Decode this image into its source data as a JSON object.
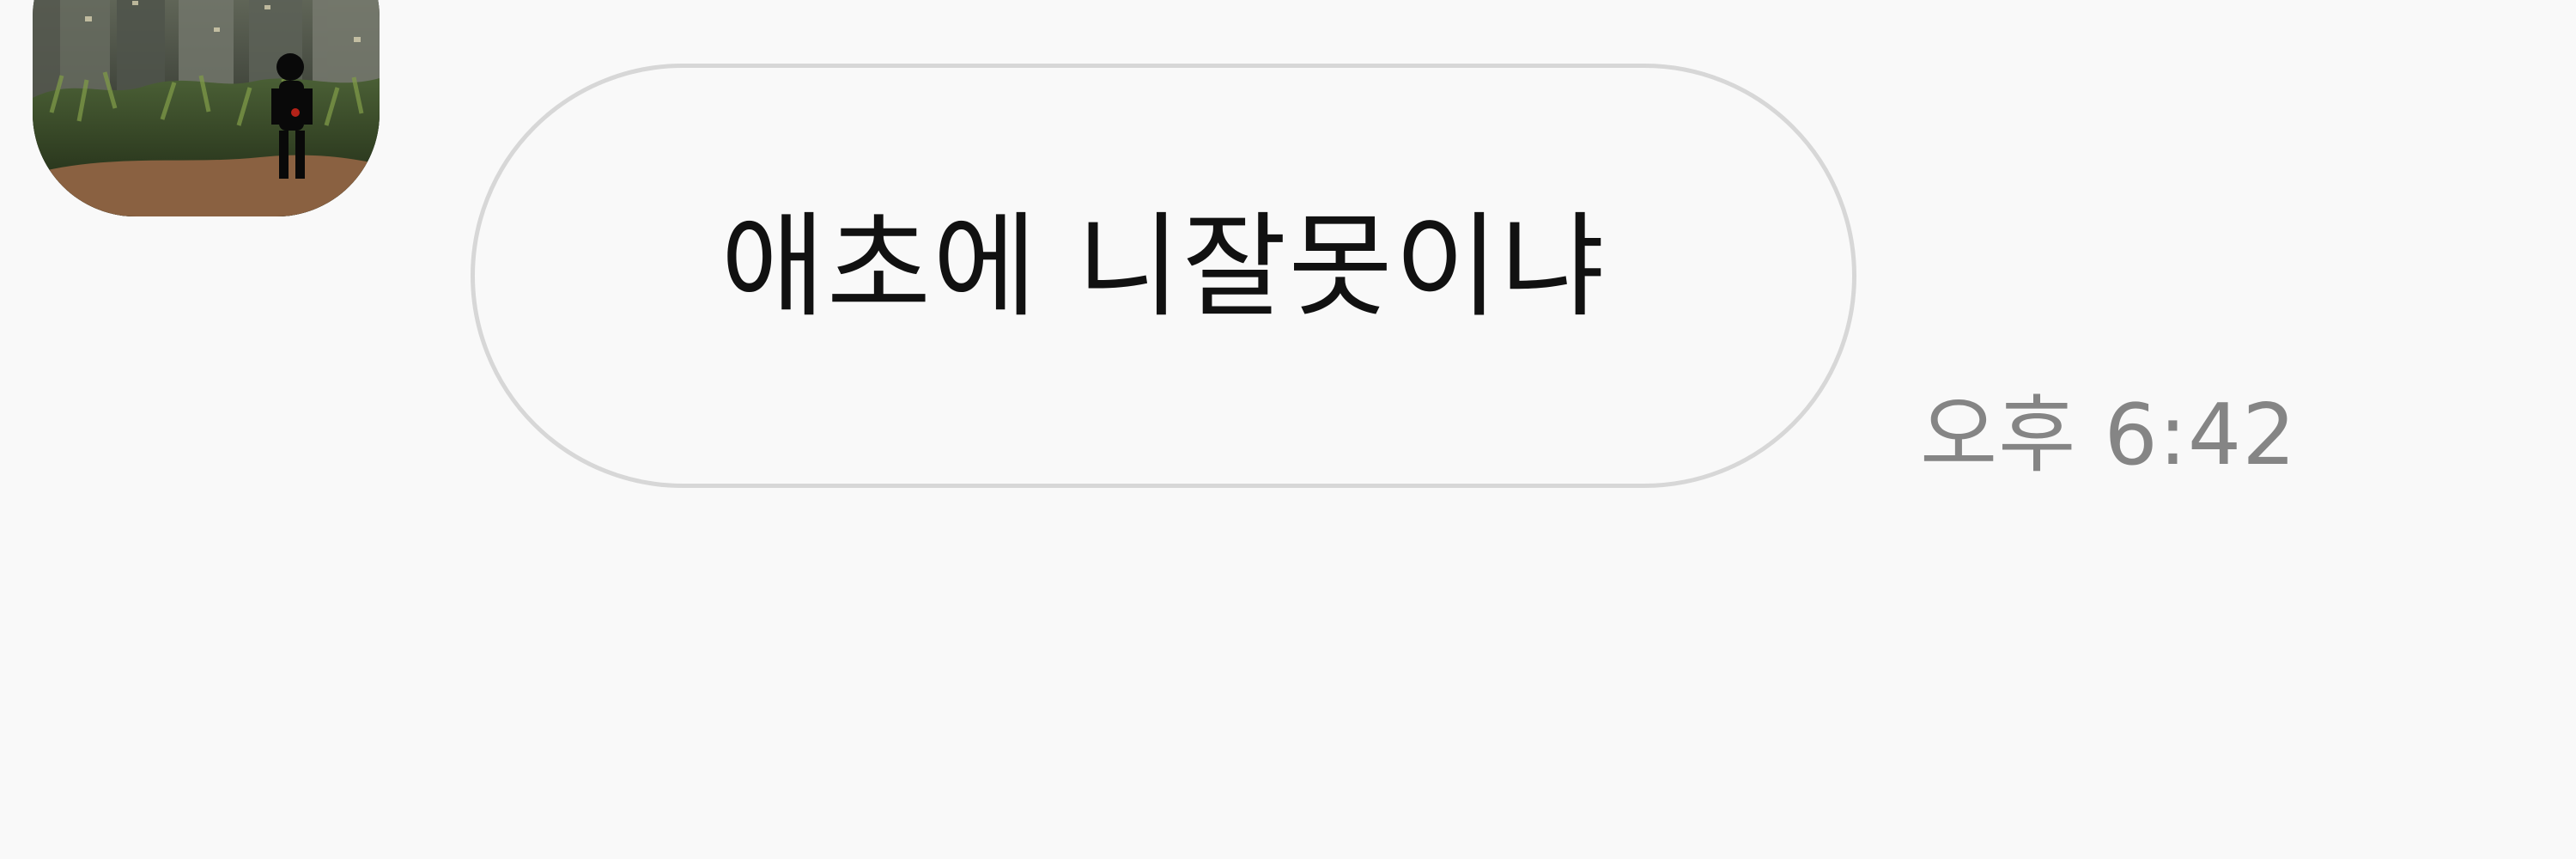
{
  "conversation": {
    "message": {
      "text": "애초에 니잘못이냐",
      "time": "오후 6:42",
      "sender_avatar": {
        "icon": "profile-photo-avatar"
      }
    }
  },
  "colors": {
    "background": "#f9f9f9",
    "bubble_border": "#d7d7d7",
    "message_text": "#111111",
    "timestamp": "#858585"
  }
}
